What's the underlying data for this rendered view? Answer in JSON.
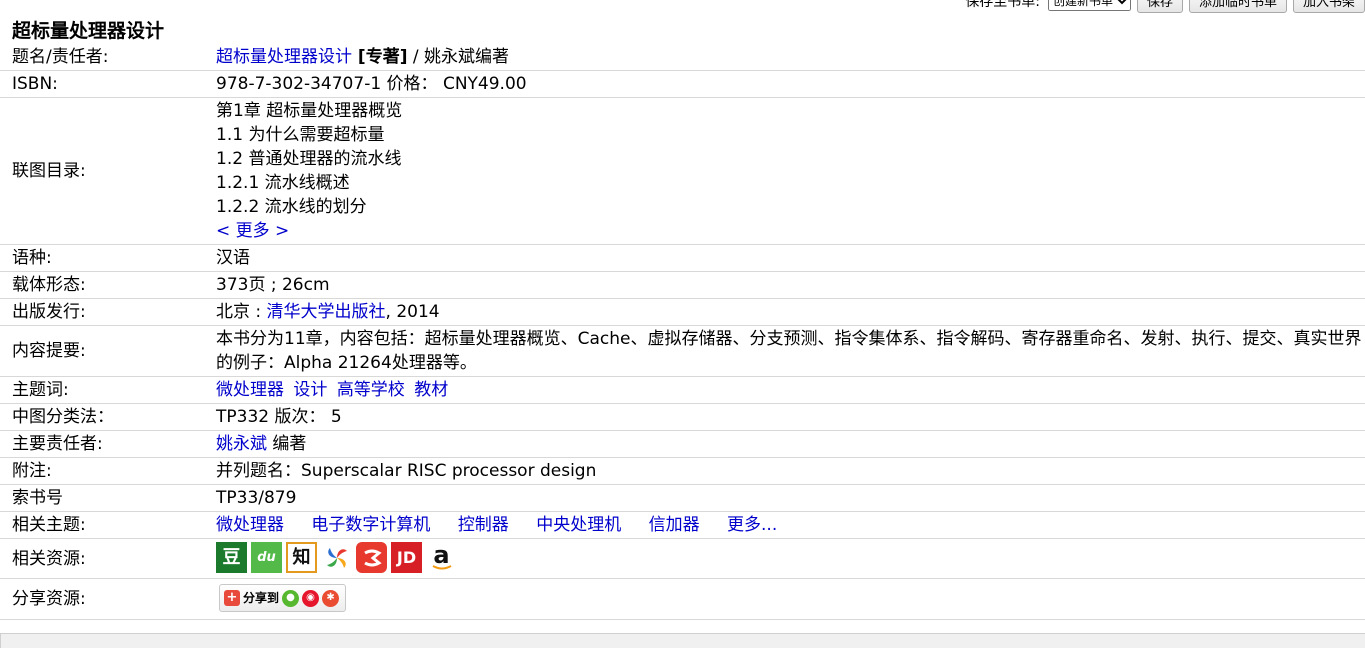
{
  "toolbar": {
    "save_to_label": "保存至书单:",
    "select_value": "创建新书单",
    "save_button": "保存",
    "add_temp_button": "添加临时书单",
    "add_booklist_button": "加入书架"
  },
  "book": {
    "title": "超标量处理器设计"
  },
  "fields": {
    "title_resp": {
      "label": "题名/责任者:",
      "title_link": "超标量处理器设计",
      "type": " [专著]",
      "resp": " / 姚永斌编著"
    },
    "isbn": {
      "label": "ISBN:",
      "value": "978-7-302-34707-1 价格： CNY49.00"
    },
    "toc": {
      "label": "联图目录:",
      "lines": [
        "第1章 超标量处理器概览",
        "1.1 为什么需要超标量",
        "1.2 普通处理器的流水线",
        "1.2.1 流水线概述",
        "1.2.2 流水线的划分"
      ],
      "more": "< 更多 >"
    },
    "language": {
      "label": "语种:",
      "value": "汉语"
    },
    "format": {
      "label": "载体形态:",
      "value": "373页 ; 26cm"
    },
    "publish": {
      "label": "出版发行:",
      "place": "北京 : ",
      "publisher": "清华大学出版社",
      "year": ", 2014"
    },
    "summary": {
      "label": "内容提要:",
      "value": "本书分为11章，内容包括：超标量处理器概览、Cache、虚拟存储器、分支预测、指令集体系、指令解码、寄存器重命名、发射、执行、提交、真实世界的例子：Alpha 21264处理器等。"
    },
    "subject": {
      "label": "主题词:",
      "links": [
        "微处理器",
        "设计",
        "高等学校",
        "教材"
      ]
    },
    "clc": {
      "label": "中图分类法：",
      "value": "TP332 版次： 5"
    },
    "author": {
      "label": "主要责任者:",
      "name": "姚永斌",
      "role": " 编著"
    },
    "note": {
      "label": "附注:",
      "value": "并列题名：Superscalar RISC processor design"
    },
    "callno": {
      "label": "索书号",
      "value": "TP33/879"
    },
    "related_topics": {
      "label": "相关主题:",
      "links": [
        "微处理器",
        "电子数字计算机",
        "控制器",
        "中央处理机",
        "信加器",
        "更多..."
      ]
    },
    "related_resources": {
      "label": "相关资源:"
    },
    "share": {
      "label": "分享资源:",
      "button_text": "分享到"
    }
  },
  "icons": {
    "douban": "豆",
    "du": "du",
    "zhi": "知",
    "jd": "JD",
    "amazon": "a"
  },
  "colors": {
    "link": "#0000cc",
    "douban": "#1b7a2b",
    "baidu": "#53b948",
    "dangdang": "#e8392f",
    "jd": "#d71f26"
  }
}
